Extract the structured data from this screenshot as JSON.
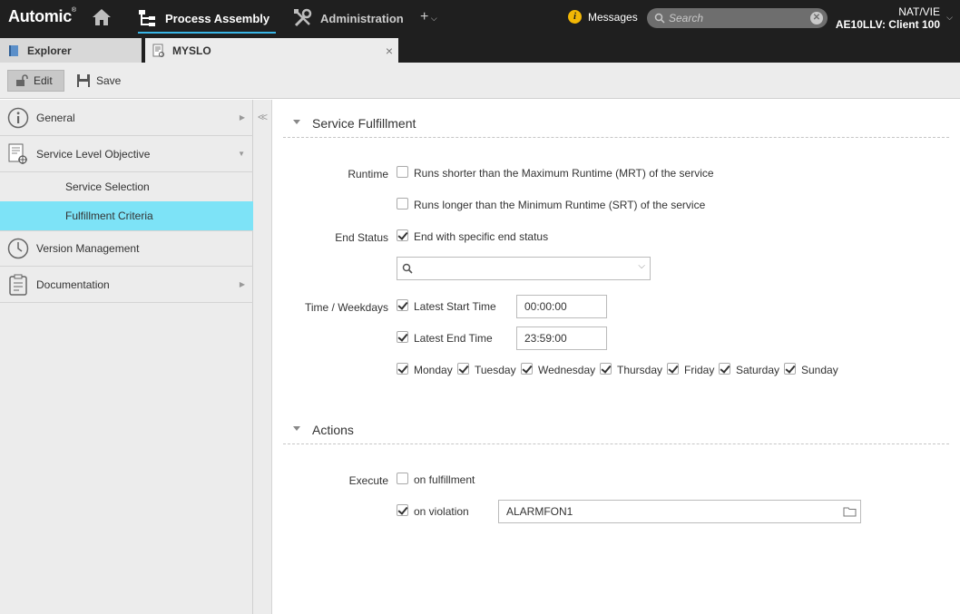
{
  "topbar": {
    "logo": "Automic",
    "logo_mark": "®",
    "nav_process_assembly": "Process Assembly",
    "nav_administration": "Administration",
    "nav_plus": "+",
    "messages_label": "Messages",
    "messages_icon": "i",
    "search_placeholder": "Search",
    "search_clear": "✕",
    "user_line1": "NAT/VIE",
    "user_line2": "AE10LLV: Client 100"
  },
  "tabs": {
    "explorer": "Explorer",
    "object": "MYSLO",
    "close": "×"
  },
  "toolbar": {
    "edit": "Edit",
    "save": "Save"
  },
  "leftnav": {
    "general": "General",
    "slo": "Service Level Objective",
    "service_selection": "Service Selection",
    "fulfillment_criteria": "Fulfillment Criteria",
    "version_management": "Version Management",
    "documentation": "Documentation",
    "active_item": "Fulfillment Criteria"
  },
  "fulfillment": {
    "title": "Service Fulfillment",
    "runtime_label": "Runtime",
    "runtime_shorter": "Runs shorter than the Maximum Runtime (MRT) of the service",
    "runtime_shorter_checked": false,
    "runtime_longer": "Runs longer than the Minimum Runtime (SRT) of the service",
    "runtime_longer_checked": false,
    "end_status_label": "End Status",
    "end_status_option": "End with specific end status",
    "end_status_checked": true,
    "end_status_value": "",
    "time_label": "Time / Weekdays",
    "latest_start_label": "Latest Start Time",
    "latest_start_checked": true,
    "latest_start_value": "00:00:00",
    "latest_end_label": "Latest End Time",
    "latest_end_checked": true,
    "latest_end_value": "23:59:00",
    "weekdays": [
      {
        "label": "Monday",
        "checked": true
      },
      {
        "label": "Tuesday",
        "checked": true
      },
      {
        "label": "Wednesday",
        "checked": true
      },
      {
        "label": "Thursday",
        "checked": true
      },
      {
        "label": "Friday",
        "checked": true
      },
      {
        "label": "Saturday",
        "checked": true
      },
      {
        "label": "Sunday",
        "checked": true
      }
    ]
  },
  "actions": {
    "title": "Actions",
    "execute_label": "Execute",
    "on_fulfillment": "on fulfillment",
    "on_fulfillment_checked": false,
    "on_violation": "on violation",
    "on_violation_checked": true,
    "violation_object": "ALARMFON1"
  },
  "colors": {
    "topbar_bg": "#1f1f1f",
    "accent_underline": "#39b5e6",
    "active_nav_bg": "#7de3f7",
    "messages_badge": "#f2b705"
  }
}
